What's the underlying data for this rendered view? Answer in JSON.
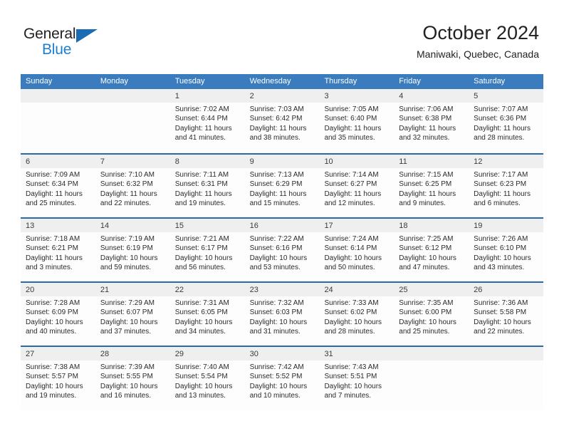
{
  "brand": {
    "name_part1": "General",
    "name_part2": "Blue",
    "accent_color": "#1b7fd4",
    "triangle_color": "#1b6cb5"
  },
  "header": {
    "title": "October 2024",
    "subtitle": "Maniwaki, Quebec, Canada"
  },
  "calendar": {
    "header_bg": "#3a7cbe",
    "row_divider": "#2a6aa8",
    "date_band_bg": "#efefef",
    "day_names": [
      "Sunday",
      "Monday",
      "Tuesday",
      "Wednesday",
      "Thursday",
      "Friday",
      "Saturday"
    ],
    "weeks": [
      [
        {
          "date": "",
          "lines": []
        },
        {
          "date": "",
          "lines": []
        },
        {
          "date": "1",
          "lines": [
            "Sunrise: 7:02 AM",
            "Sunset: 6:44 PM",
            "Daylight: 11 hours",
            "and 41 minutes."
          ]
        },
        {
          "date": "2",
          "lines": [
            "Sunrise: 7:03 AM",
            "Sunset: 6:42 PM",
            "Daylight: 11 hours",
            "and 38 minutes."
          ]
        },
        {
          "date": "3",
          "lines": [
            "Sunrise: 7:05 AM",
            "Sunset: 6:40 PM",
            "Daylight: 11 hours",
            "and 35 minutes."
          ]
        },
        {
          "date": "4",
          "lines": [
            "Sunrise: 7:06 AM",
            "Sunset: 6:38 PM",
            "Daylight: 11 hours",
            "and 32 minutes."
          ]
        },
        {
          "date": "5",
          "lines": [
            "Sunrise: 7:07 AM",
            "Sunset: 6:36 PM",
            "Daylight: 11 hours",
            "and 28 minutes."
          ]
        }
      ],
      [
        {
          "date": "6",
          "lines": [
            "Sunrise: 7:09 AM",
            "Sunset: 6:34 PM",
            "Daylight: 11 hours",
            "and 25 minutes."
          ]
        },
        {
          "date": "7",
          "lines": [
            "Sunrise: 7:10 AM",
            "Sunset: 6:32 PM",
            "Daylight: 11 hours",
            "and 22 minutes."
          ]
        },
        {
          "date": "8",
          "lines": [
            "Sunrise: 7:11 AM",
            "Sunset: 6:31 PM",
            "Daylight: 11 hours",
            "and 19 minutes."
          ]
        },
        {
          "date": "9",
          "lines": [
            "Sunrise: 7:13 AM",
            "Sunset: 6:29 PM",
            "Daylight: 11 hours",
            "and 15 minutes."
          ]
        },
        {
          "date": "10",
          "lines": [
            "Sunrise: 7:14 AM",
            "Sunset: 6:27 PM",
            "Daylight: 11 hours",
            "and 12 minutes."
          ]
        },
        {
          "date": "11",
          "lines": [
            "Sunrise: 7:15 AM",
            "Sunset: 6:25 PM",
            "Daylight: 11 hours",
            "and 9 minutes."
          ]
        },
        {
          "date": "12",
          "lines": [
            "Sunrise: 7:17 AM",
            "Sunset: 6:23 PM",
            "Daylight: 11 hours",
            "and 6 minutes."
          ]
        }
      ],
      [
        {
          "date": "13",
          "lines": [
            "Sunrise: 7:18 AM",
            "Sunset: 6:21 PM",
            "Daylight: 11 hours",
            "and 3 minutes."
          ]
        },
        {
          "date": "14",
          "lines": [
            "Sunrise: 7:19 AM",
            "Sunset: 6:19 PM",
            "Daylight: 10 hours",
            "and 59 minutes."
          ]
        },
        {
          "date": "15",
          "lines": [
            "Sunrise: 7:21 AM",
            "Sunset: 6:17 PM",
            "Daylight: 10 hours",
            "and 56 minutes."
          ]
        },
        {
          "date": "16",
          "lines": [
            "Sunrise: 7:22 AM",
            "Sunset: 6:16 PM",
            "Daylight: 10 hours",
            "and 53 minutes."
          ]
        },
        {
          "date": "17",
          "lines": [
            "Sunrise: 7:24 AM",
            "Sunset: 6:14 PM",
            "Daylight: 10 hours",
            "and 50 minutes."
          ]
        },
        {
          "date": "18",
          "lines": [
            "Sunrise: 7:25 AM",
            "Sunset: 6:12 PM",
            "Daylight: 10 hours",
            "and 47 minutes."
          ]
        },
        {
          "date": "19",
          "lines": [
            "Sunrise: 7:26 AM",
            "Sunset: 6:10 PM",
            "Daylight: 10 hours",
            "and 43 minutes."
          ]
        }
      ],
      [
        {
          "date": "20",
          "lines": [
            "Sunrise: 7:28 AM",
            "Sunset: 6:09 PM",
            "Daylight: 10 hours",
            "and 40 minutes."
          ]
        },
        {
          "date": "21",
          "lines": [
            "Sunrise: 7:29 AM",
            "Sunset: 6:07 PM",
            "Daylight: 10 hours",
            "and 37 minutes."
          ]
        },
        {
          "date": "22",
          "lines": [
            "Sunrise: 7:31 AM",
            "Sunset: 6:05 PM",
            "Daylight: 10 hours",
            "and 34 minutes."
          ]
        },
        {
          "date": "23",
          "lines": [
            "Sunrise: 7:32 AM",
            "Sunset: 6:03 PM",
            "Daylight: 10 hours",
            "and 31 minutes."
          ]
        },
        {
          "date": "24",
          "lines": [
            "Sunrise: 7:33 AM",
            "Sunset: 6:02 PM",
            "Daylight: 10 hours",
            "and 28 minutes."
          ]
        },
        {
          "date": "25",
          "lines": [
            "Sunrise: 7:35 AM",
            "Sunset: 6:00 PM",
            "Daylight: 10 hours",
            "and 25 minutes."
          ]
        },
        {
          "date": "26",
          "lines": [
            "Sunrise: 7:36 AM",
            "Sunset: 5:58 PM",
            "Daylight: 10 hours",
            "and 22 minutes."
          ]
        }
      ],
      [
        {
          "date": "27",
          "lines": [
            "Sunrise: 7:38 AM",
            "Sunset: 5:57 PM",
            "Daylight: 10 hours",
            "and 19 minutes."
          ]
        },
        {
          "date": "28",
          "lines": [
            "Sunrise: 7:39 AM",
            "Sunset: 5:55 PM",
            "Daylight: 10 hours",
            "and 16 minutes."
          ]
        },
        {
          "date": "29",
          "lines": [
            "Sunrise: 7:40 AM",
            "Sunset: 5:54 PM",
            "Daylight: 10 hours",
            "and 13 minutes."
          ]
        },
        {
          "date": "30",
          "lines": [
            "Sunrise: 7:42 AM",
            "Sunset: 5:52 PM",
            "Daylight: 10 hours",
            "and 10 minutes."
          ]
        },
        {
          "date": "31",
          "lines": [
            "Sunrise: 7:43 AM",
            "Sunset: 5:51 PM",
            "Daylight: 10 hours",
            "and 7 minutes."
          ]
        },
        {
          "date": "",
          "lines": []
        },
        {
          "date": "",
          "lines": []
        }
      ]
    ]
  }
}
